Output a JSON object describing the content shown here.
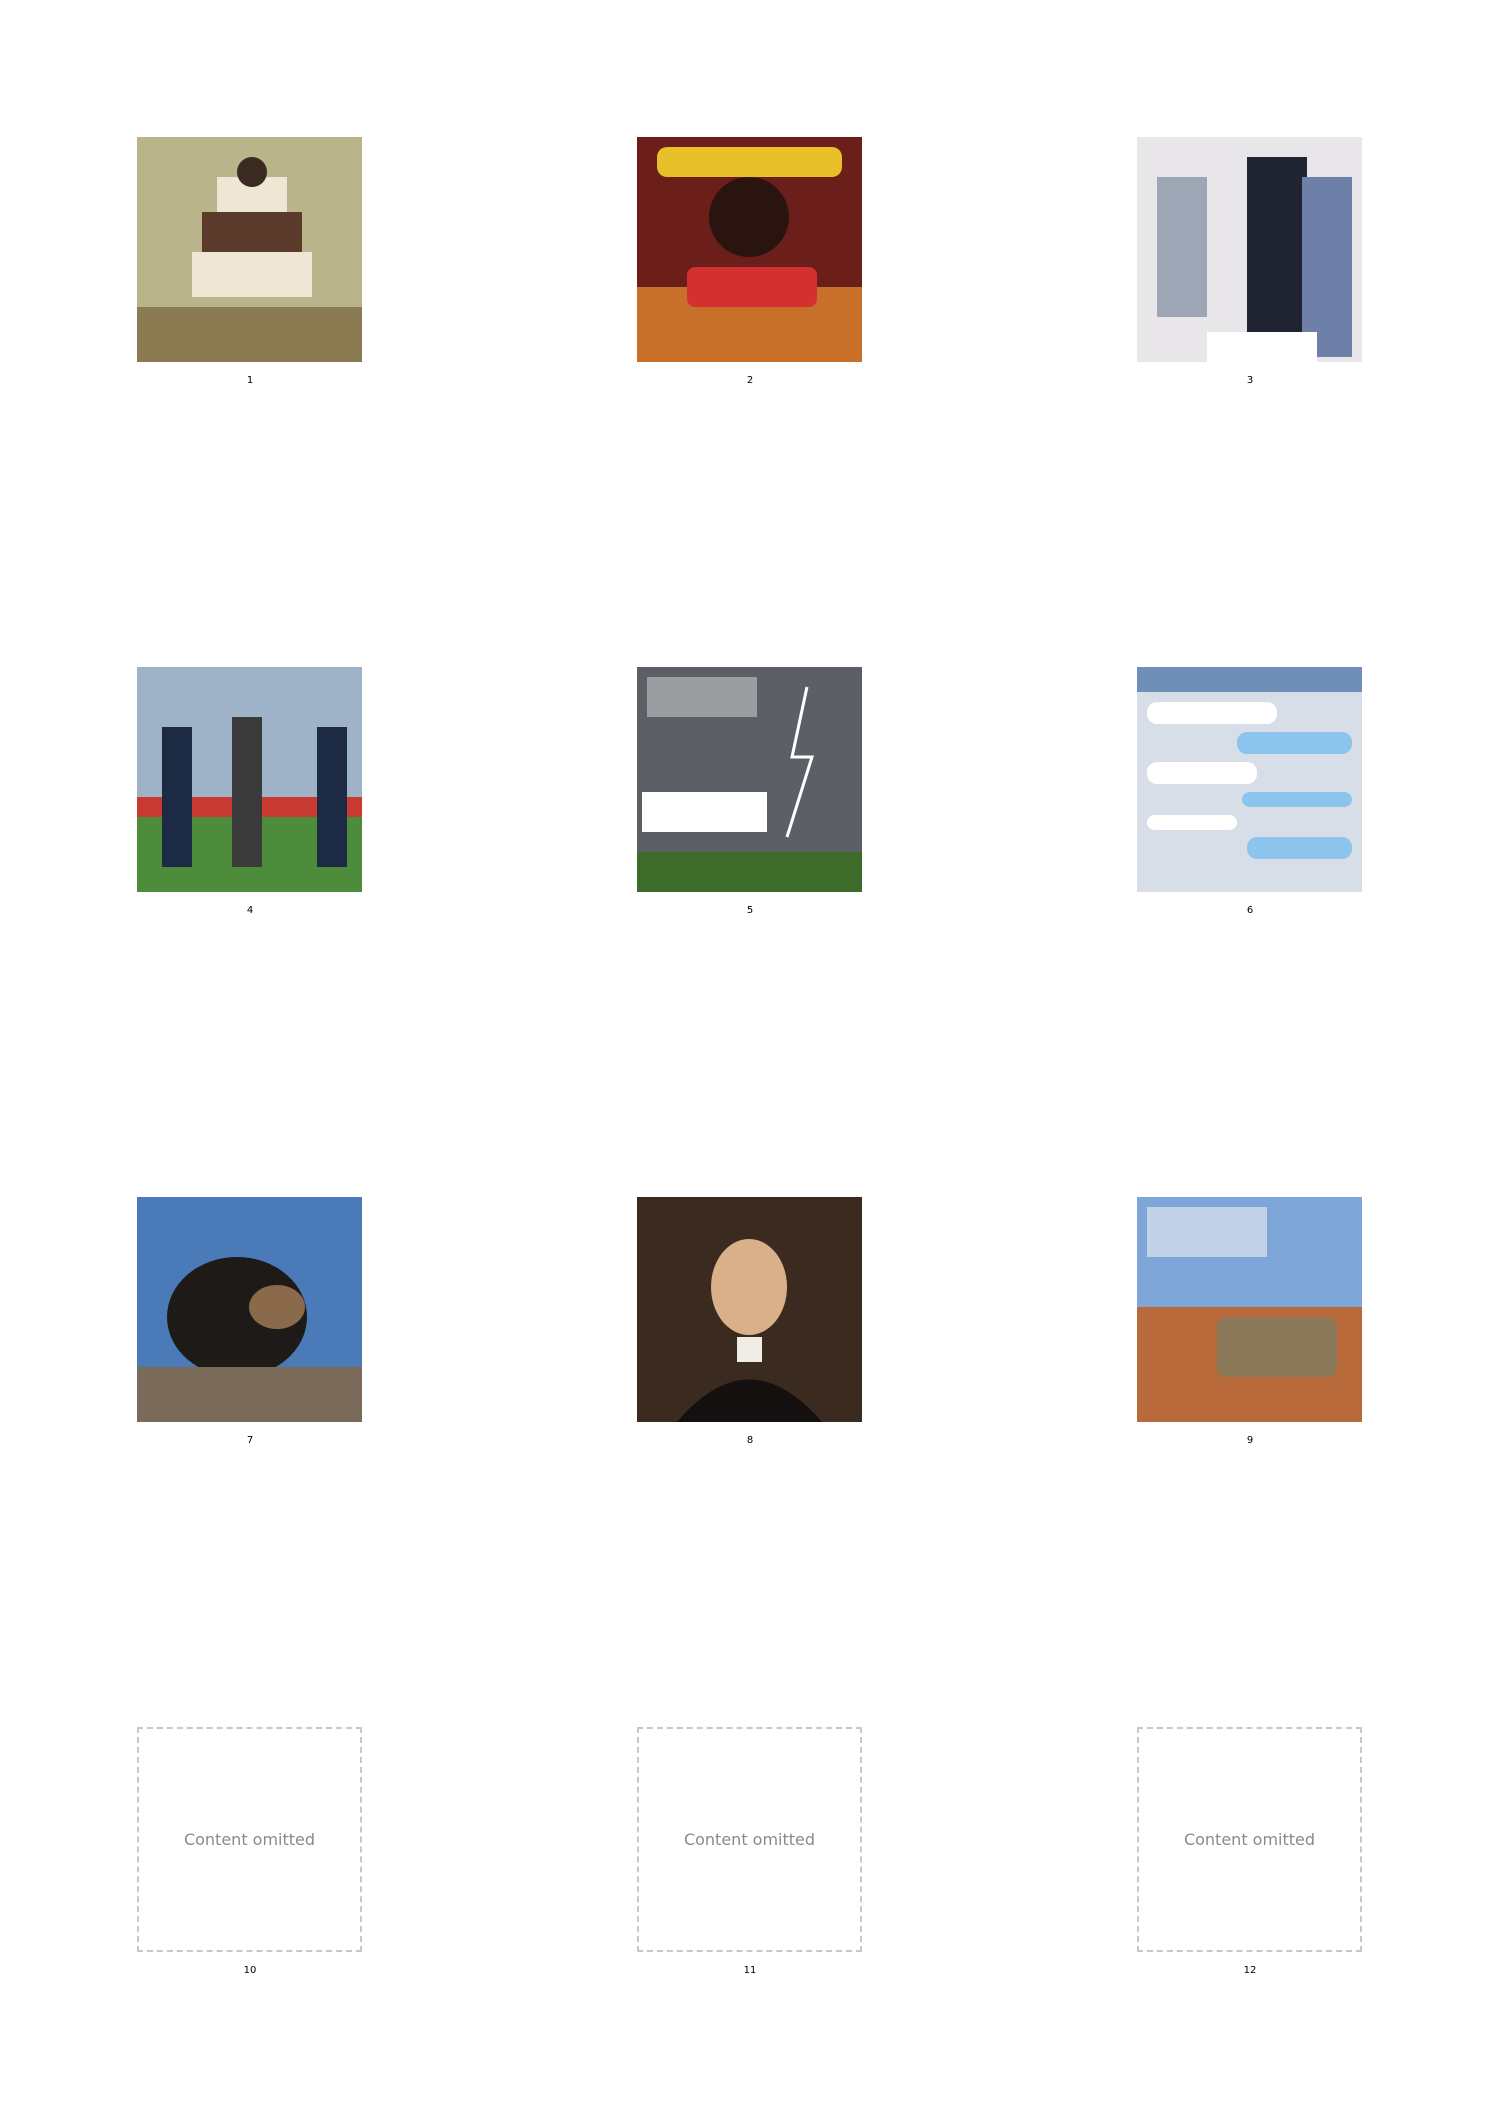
{
  "panels": [
    {
      "number": "1",
      "icon": "tiered-cake-photo-icon"
    },
    {
      "number": "2",
      "icon": "concert-poster-icon"
    },
    {
      "number": "3",
      "icon": "fashion-photo-icon"
    },
    {
      "number": "4",
      "icon": "soccer-match-photo-icon"
    },
    {
      "number": "5",
      "icon": "storm-concert-poster-icon"
    },
    {
      "number": "6",
      "icon": "text-message-screenshot-icon"
    },
    {
      "number": "7",
      "icon": "bear-meme-icon"
    },
    {
      "number": "8",
      "icon": "portrait-painting-icon"
    },
    {
      "number": "9",
      "icon": "desert-car-photo-icon"
    },
    {
      "number": "10",
      "placeholder": "Content omitted"
    },
    {
      "number": "11",
      "placeholder": "Content omitted"
    },
    {
      "number": "12",
      "placeholder": "Content omitted"
    }
  ],
  "colors": {
    "accent": "#e8141b",
    "background": "#ffffff"
  }
}
